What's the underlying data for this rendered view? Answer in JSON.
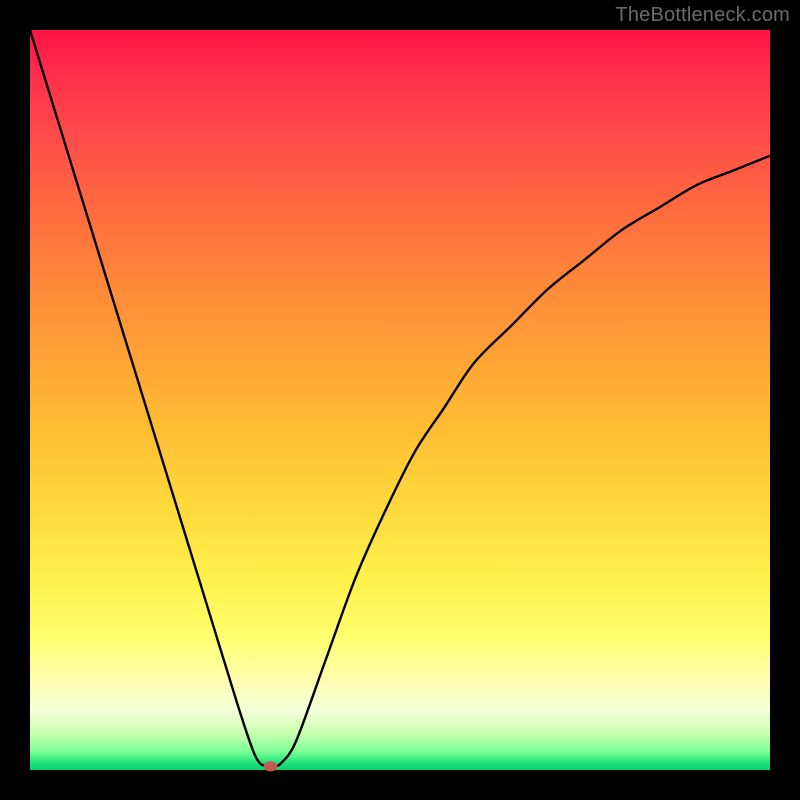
{
  "watermark": {
    "text": "TheBottleneck.com"
  },
  "chart_data": {
    "type": "line",
    "title": "",
    "xlabel": "",
    "ylabel": "",
    "xlim": [
      0,
      100
    ],
    "ylim": [
      0,
      100
    ],
    "grid": false,
    "series": [
      {
        "name": "bottleneck-curve",
        "x": [
          0,
          4,
          8,
          12,
          16,
          20,
          24,
          28,
          30,
          31,
          32,
          33,
          34,
          36,
          40,
          44,
          48,
          52,
          56,
          60,
          65,
          70,
          75,
          80,
          85,
          90,
          95,
          100
        ],
        "values": [
          100,
          87,
          74,
          61,
          48,
          35,
          22,
          9,
          3,
          1,
          0.5,
          0.5,
          1,
          4,
          15,
          26,
          35,
          43,
          49,
          55,
          60,
          65,
          69,
          73,
          76,
          79,
          81,
          83
        ]
      }
    ],
    "marker": {
      "x": 32.5,
      "y": 0.5,
      "color": "#c25a52"
    },
    "gradient_stops": [
      {
        "pct": 0,
        "color": "#ff1247"
      },
      {
        "pct": 50,
        "color": "#ffbd33"
      },
      {
        "pct": 88,
        "color": "#fdffb0"
      },
      {
        "pct": 100,
        "color": "#0ad16e"
      }
    ]
  }
}
